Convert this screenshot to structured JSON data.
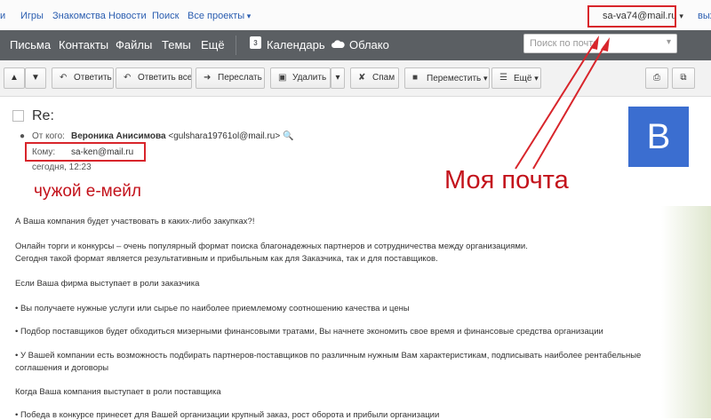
{
  "portal": {
    "links": [
      "Игры",
      "Знакомства",
      "Новости",
      "Поиск",
      "Все проекты"
    ],
    "account": "sa-va74@mail.ru",
    "logout": "выход"
  },
  "nav": {
    "items": [
      "Письма",
      "Контакты",
      "Файлы",
      "Темы",
      "Ещё"
    ],
    "calendar": "Календарь",
    "calendar_day": "3",
    "cloud": "Облако",
    "search_placeholder": "Поиск по почте"
  },
  "toolbar": {
    "reply": "Ответить",
    "reply_all": "Ответить всем",
    "forward": "Переслать",
    "delete": "Удалить",
    "spam": "Спам",
    "move": "Переместить",
    "more": "Ещё"
  },
  "message": {
    "subject": "Re:",
    "from_label": "От кого:",
    "from_name": "Вероника Анисимова",
    "from_email": "<gulshara19761ol@mail.ru>",
    "to_label": "Кому:",
    "to_value": "sa-ken@mail.ru",
    "date": "сегодня, 12:23",
    "avatar_letter": "В"
  },
  "annotations": {
    "mine": "Моя почта",
    "other": "чужой е-мейл"
  },
  "body_lines": [
    "А Ваша компания будет участвовать в каких-либо закупках?!",
    "Онлайн торги и конкурсы – очень популярный формат поиска благонадежных партнеров и сотрудничества между организациями.",
    "Сегодня такой формат является результативным и прибыльным как для Заказчика, так и для поставщиков.",
    "Если Ваша фирма выступает в роли заказчика",
    "• Вы получаете нужные услуги или сырье по наиболее приемлемому соотношению качества и цены",
    "• Подбор поставщиков будет обходиться мизерными финансовыми тратами, Вы начнете экономить свое время и финансовые средства организации",
    "• У Вашей компании есть возможность подбирать партнеров-поставщиков по различным нужным Вам характеристикам, подписывать наиболее рентабельные",
    "соглашения и договоры",
    "Когда Ваша компания выступает в роли поставщика",
    "• Победа в конкурсе принесет для Вашей организации крупный заказ, рост оборота и прибыли организации"
  ],
  "colors": {
    "nav_bg": "#5b5f63",
    "annotation_red": "#d8252b",
    "avatar_bg": "#3b6ed0"
  }
}
